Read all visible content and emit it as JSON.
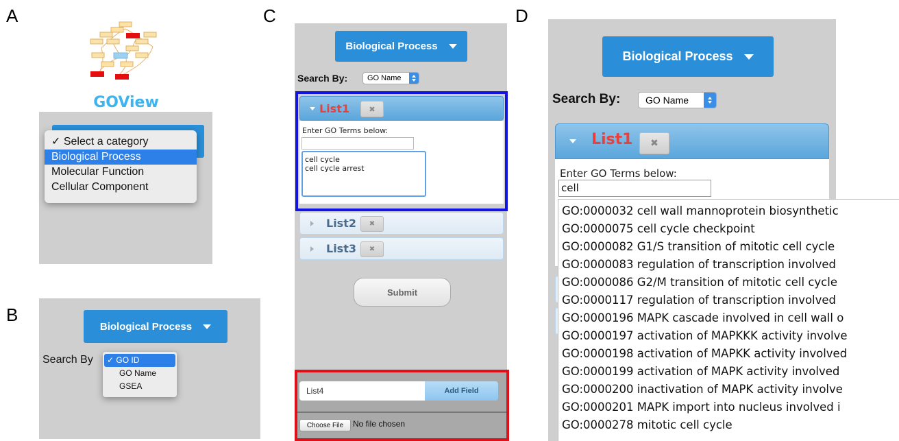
{
  "panels": {
    "a": {
      "letter": "A",
      "logo_text": "GOView",
      "menu": {
        "options": [
          "✓ Select a category",
          "Biological Process",
          "Molecular Function",
          "Cellular Component"
        ],
        "selected_index": 1
      }
    },
    "b": {
      "letter": "B",
      "category_button": "Biological Process",
      "search_by_label": "Search By",
      "menu": {
        "options": [
          "✓ GO ID",
          "GO Name",
          "GSEA"
        ],
        "selected_index": 0
      }
    },
    "c": {
      "letter": "C",
      "category_button": "Biological Process",
      "search_by_label": "Search By:",
      "search_by_value": "GO Name",
      "lists": [
        {
          "title": "List1",
          "active": true
        },
        {
          "title": "List2",
          "active": false
        },
        {
          "title": "List3",
          "active": false
        }
      ],
      "close_glyph": "✖",
      "enter_label": "Enter GO Terms below:",
      "textarea_lines": [
        "cell cycle",
        "cell cycle arrest"
      ],
      "submit_label": "Submit",
      "new_field_value": "List4",
      "add_field_label": "Add Field",
      "choose_file_label": "Choose File",
      "no_file_label": "No file chosen"
    },
    "d": {
      "letter": "D",
      "category_button": "Biological Process",
      "search_by_label": "Search By:",
      "search_by_value": "GO Name",
      "list_title": "List1",
      "close_glyph": "✖",
      "enter_label": "Enter GO Terms below:",
      "input_value": "cell",
      "suggestions": [
        "GO:0000032 cell wall mannoprotein biosynthetic",
        "GO:0000075 cell cycle checkpoint",
        "GO:0000082 G1/S transition of mitotic cell cycle",
        "GO:0000083 regulation of transcription involved",
        "GO:0000086 G2/M transition of mitotic cell cycle",
        "GO:0000117 regulation of transcription involved",
        "GO:0000196 MAPK cascade involved in cell wall o",
        "GO:0000197 activation of MAPKKK activity involve",
        "GO:0000198 activation of MAPKK activity involved",
        "GO:0000199 activation of MAPK activity involved",
        "GO:0000200 inactivation of MAPK activity involve",
        "GO:0000201 MAPK import into nucleus involved i",
        "GO:0000278 mitotic cell cycle"
      ]
    }
  },
  "colors": {
    "accent_blue": "#2a8fd8",
    "list_title_red": "#e8403c",
    "highlight_blue": "#1414e0",
    "highlight_red": "#e0101a",
    "logo_text": "#3db4ee"
  }
}
